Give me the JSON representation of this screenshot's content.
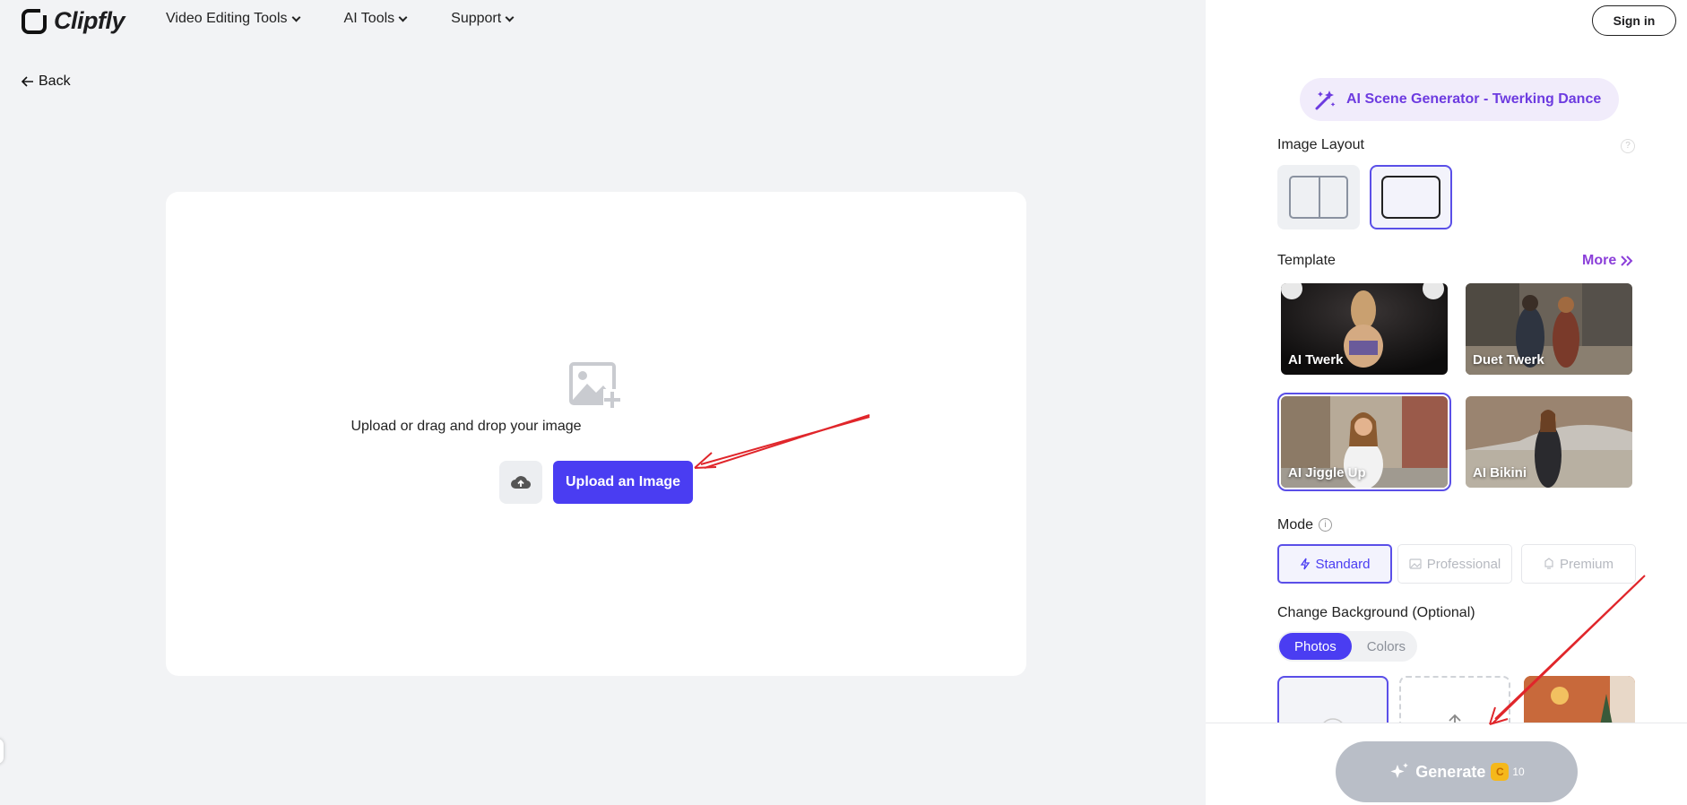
{
  "brand": {
    "name": "Clipfly"
  },
  "nav": {
    "items": [
      {
        "label": "Video Editing Tools"
      },
      {
        "label": "AI Tools"
      },
      {
        "label": "Support"
      }
    ]
  },
  "back_label": "Back",
  "upload": {
    "prompt": "Upload or drag and drop your image",
    "button_label": "Upload an Image"
  },
  "panel": {
    "signin_label": "Sign in",
    "scene_title": "AI Scene Generator - Twerking Dance",
    "image_layout_label": "Image Layout",
    "help_symbol": "?",
    "template_label": "Template",
    "more_label": "More",
    "templates": [
      {
        "label": "AI Twerk"
      },
      {
        "label": "Duet Twerk"
      },
      {
        "label": "AI Jiggle Up"
      },
      {
        "label": "AI Bikini"
      }
    ],
    "selected_template": "AI Jiggle Up",
    "mode_label": "Mode",
    "info_symbol": "i",
    "modes": [
      {
        "label": "Standard"
      },
      {
        "label": "Professional"
      },
      {
        "label": "Premium"
      }
    ],
    "selected_mode": "Standard",
    "change_bg_label": "Change Background (Optional)",
    "bg_tabs": [
      {
        "label": "Photos"
      },
      {
        "label": "Colors"
      }
    ],
    "selected_bg_tab": "Photos",
    "generate_label": "Generate",
    "coin_symbol": "C",
    "credit_cost": "10"
  },
  "colors": {
    "accent": "#4a3df2",
    "purple": "#8b3fd9",
    "disabled": "#b9bec7",
    "annotation": "#e0262b"
  }
}
